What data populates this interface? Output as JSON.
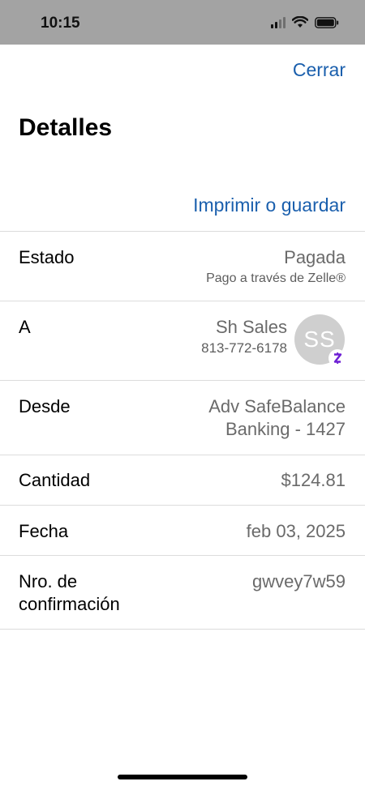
{
  "status_bar": {
    "time": "10:15"
  },
  "header": {
    "close_label": "Cerrar",
    "title": "Detalles",
    "print_label": "Imprimir o guardar"
  },
  "details": {
    "status": {
      "label": "Estado",
      "value": "Pagada",
      "subvalue": "Pago a través de Zelle®"
    },
    "to": {
      "label": "A",
      "name": "Sh Sales",
      "phone": "813-772-6178",
      "avatar_initials": "SS",
      "badge_glyph": "Z"
    },
    "from": {
      "label": "Desde",
      "value_line1": "Adv SafeBalance",
      "value_line2": "Banking - 1427"
    },
    "amount": {
      "label": "Cantidad",
      "value": "$124.81"
    },
    "date": {
      "label": "Fecha",
      "value": "feb 03, 2025"
    },
    "confirmation": {
      "label_line1": "Nro. de",
      "label_line2": "confirmación",
      "value": "gwvey7w59"
    }
  },
  "colors": {
    "link": "#1a5fad",
    "zelle_purple": "#6d1ed4",
    "status_bar_bg": "#a3a3a3"
  }
}
